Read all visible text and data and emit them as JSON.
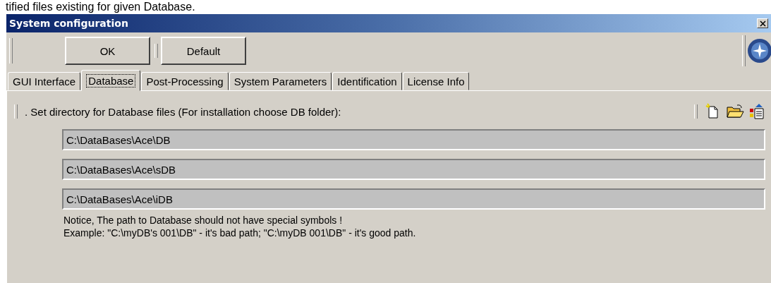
{
  "document_text": "tified files existing for given Database.",
  "window": {
    "title": "System configuration"
  },
  "buttons": [
    "OK",
    "Default"
  ],
  "tabs": [
    {
      "label": "GUI Interface",
      "selected": false
    },
    {
      "label": "Database",
      "selected": true
    },
    {
      "label": "Post-Processing",
      "selected": false
    },
    {
      "label": "System Parameters",
      "selected": false
    },
    {
      "label": "Identification",
      "selected": false
    },
    {
      "label": "License Info",
      "selected": false
    }
  ],
  "section_label": ". Set directory for Database files (For installation choose DB folder):",
  "paths": [
    "C:\\DataBases\\Ace\\DB",
    "C:\\DataBases\\Ace\\sDB",
    "C:\\DataBases\\Ace\\iDB"
  ],
  "notice": [
    "Notice, The path to Database should not have special symbols !",
    "Example: \"C:\\myDB's 001\\DB\" - it's bad path; \"C:\\myDB 001\\DB\" - it's good path."
  ]
}
